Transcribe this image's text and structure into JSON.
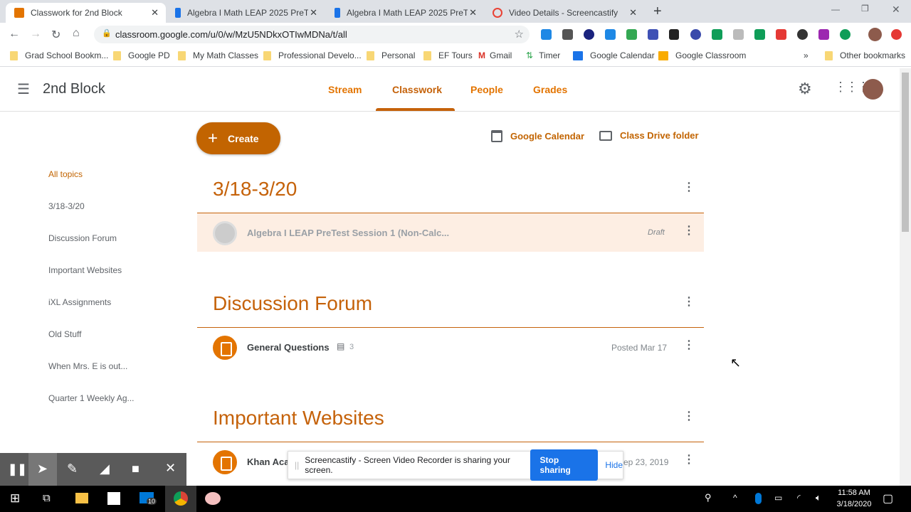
{
  "browser": {
    "tabs": [
      {
        "title": "Classwork for 2nd Block",
        "active": true
      },
      {
        "title": "Algebra I Math LEAP 2025 PreTe"
      },
      {
        "title": "Algebra I Math LEAP 2025 PreTe"
      },
      {
        "title": "Video Details - Screencastify"
      }
    ],
    "new_tab": "+",
    "url": "classroom.google.com/u/0/w/MzU5NDkxOTIwMDNa/t/all",
    "bookmarks": [
      "Grad School Bookm...",
      "Google PD",
      "My Math Classes",
      "Professional Develo...",
      "Personal",
      "EF Tours",
      "Gmail",
      "Timer",
      "Google Calendar",
      "Google Classroom"
    ],
    "more_bookmarks": "»",
    "other_bookmarks": "Other bookmarks"
  },
  "header": {
    "title": "2nd Block",
    "tabs": [
      "Stream",
      "Classwork",
      "People",
      "Grades"
    ],
    "active_tab": "Classwork"
  },
  "toolbar": {
    "create": "Create",
    "calendar": "Google Calendar",
    "drive": "Class Drive folder"
  },
  "sidebar": {
    "items": [
      "All topics",
      "3/18-3/20",
      "Discussion Forum",
      "Important Websites",
      "iXL Assignments",
      "Old Stuff",
      "When Mrs. E is out...",
      "Quarter 1 Weekly Ag..."
    ],
    "active": "All topics"
  },
  "sections": [
    {
      "title": "3/18-3/20",
      "items": [
        {
          "title": "Algebra I LEAP PreTest Session 1 (Non-Calc...",
          "status": "Draft"
        }
      ]
    },
    {
      "title": "Discussion Forum",
      "items": [
        {
          "title": "General Questions",
          "comments": "3",
          "status": "Posted Mar 17"
        }
      ]
    },
    {
      "title": "Important Websites",
      "items": [
        {
          "title": "Khan Aca",
          "status": "ep 23, 2019"
        }
      ]
    }
  ],
  "screencastify": {
    "message": "Screencastify - Screen Video Recorder is sharing your screen.",
    "stop": "Stop sharing",
    "hide": "Hide"
  },
  "taskbar": {
    "time": "11:58 AM",
    "date": "3/18/2020",
    "mail_badge": "10"
  },
  "colors": {
    "accent": "#e37400",
    "heading": "#c5620a",
    "draft_bg": "#fdeee3",
    "stop_btn": "#1a73e8"
  }
}
